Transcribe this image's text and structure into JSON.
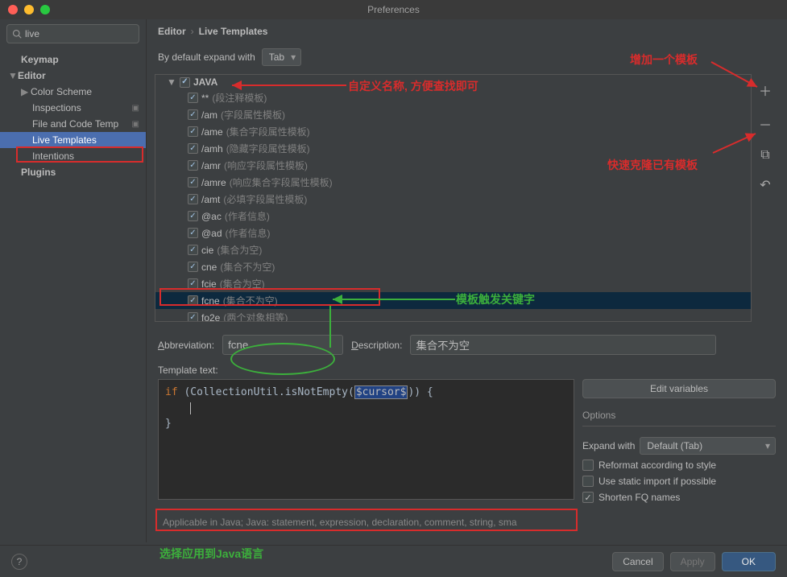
{
  "window": {
    "title": "Preferences"
  },
  "search": {
    "value": "live",
    "placeholder": ""
  },
  "sidebar": {
    "items": [
      {
        "label": "Keymap"
      },
      {
        "label": "Editor"
      },
      {
        "label": "Color Scheme"
      },
      {
        "label": "Inspections"
      },
      {
        "label": "File and Code Temp"
      },
      {
        "label": "Live Templates"
      },
      {
        "label": "Intentions"
      },
      {
        "label": "Plugins"
      }
    ]
  },
  "breadcrumb": {
    "a": "Editor",
    "b": "Live Templates"
  },
  "expand": {
    "label": "By default expand with",
    "value": "Tab"
  },
  "templates": {
    "group": "JAVA",
    "items": [
      {
        "abbr": "**",
        "desc": "(段注释模板)"
      },
      {
        "abbr": "/am",
        "desc": "(字段属性模板)"
      },
      {
        "abbr": "/ame",
        "desc": "(集合字段属性模板)"
      },
      {
        "abbr": "/amh",
        "desc": "(隐藏字段属性模板)"
      },
      {
        "abbr": "/amr",
        "desc": "(响应字段属性模板)"
      },
      {
        "abbr": "/amre",
        "desc": "(响应集合字段属性模板)"
      },
      {
        "abbr": "/amt",
        "desc": "(必填字段属性模板)"
      },
      {
        "abbr": "@ac",
        "desc": "(作者信息)"
      },
      {
        "abbr": "@ad",
        "desc": "(作者信息)"
      },
      {
        "abbr": "cie",
        "desc": "(集合为空)"
      },
      {
        "abbr": "cne",
        "desc": "(集合不为空)"
      },
      {
        "abbr": "fcie",
        "desc": "(集合为空)"
      },
      {
        "abbr": "fcne",
        "desc": "(集合不为空)"
      },
      {
        "abbr": "fo2e",
        "desc": "(两个对象相等)"
      }
    ]
  },
  "fields": {
    "abbrev_label": "Abbreviation:",
    "abbrev_value": "fcne",
    "desc_label": "Description:",
    "desc_value": "集合不为空",
    "template_text_label": "Template text:"
  },
  "code": {
    "line1a": "if",
    "line1b": " (CollectionUtil.isNotEmpty(",
    "line1c": "$cursor$",
    "line1d": ")) {",
    "line2": "    ",
    "line3": "}"
  },
  "right": {
    "edit_vars": "Edit variables",
    "options_title": "Options",
    "expand_with_label": "Expand with",
    "expand_with_value": "Default (Tab)",
    "reformat": "Reformat according to style",
    "static_import": "Use static import if possible",
    "shorten_fq": "Shorten FQ names"
  },
  "applicable": "Applicable in Java; Java: statement, expression, declaration, comment, string, sma",
  "footer": {
    "cancel": "Cancel",
    "apply": "Apply",
    "ok": "OK"
  },
  "annotations": {
    "custom_name": "自定义名称, 方便查找即可",
    "add_template": "增加一个模板",
    "clone_template": "快速克隆已有模板",
    "trigger_keyword": "模板触发关键字",
    "apply_java": "选择应用到Java语言"
  }
}
